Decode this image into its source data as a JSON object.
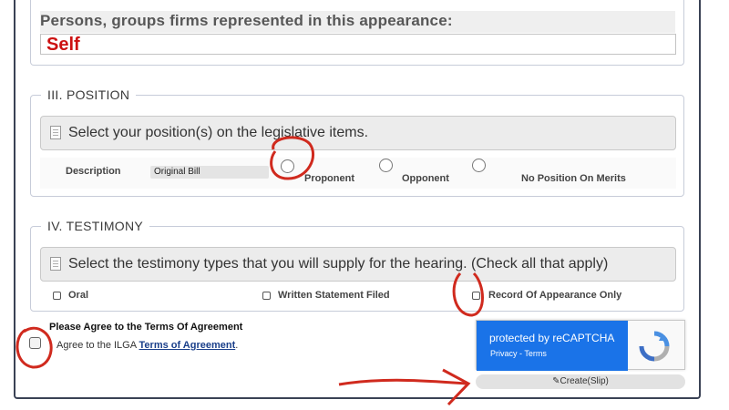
{
  "persons": {
    "label": "Persons, groups firms represented in this appearance:",
    "value": "Self"
  },
  "position": {
    "legend": "III. POSITION",
    "hint": "Select your position(s) on the legislative items.",
    "description_label": "Description",
    "bill_select_value": "Original Bill",
    "options": [
      "Proponent",
      "Opponent",
      "No Position On Merits"
    ]
  },
  "testimony": {
    "legend": "IV. TESTIMONY",
    "hint": "Select the testimony types that you will supply for the hearing. (Check all that apply)",
    "options": [
      "Oral",
      "Written Statement Filed",
      "Record Of Appearance Only"
    ]
  },
  "agreement": {
    "title": "Please Agree to the Terms Of Agreement",
    "text_prefix": "Agree to the ILGA ",
    "link_text": "Terms of Agreement",
    "text_suffix": "."
  },
  "recaptcha": {
    "title": "protected by reCAPTCHA",
    "privacy": "Privacy",
    "separator": " - ",
    "terms": "Terms"
  },
  "create_button": "Create(Slip)",
  "colors": {
    "recaptcha_blue": "#1a73e8",
    "annotation_red": "#d02a1e",
    "self_text": "#cc1111",
    "link": "#1a3f8a"
  }
}
